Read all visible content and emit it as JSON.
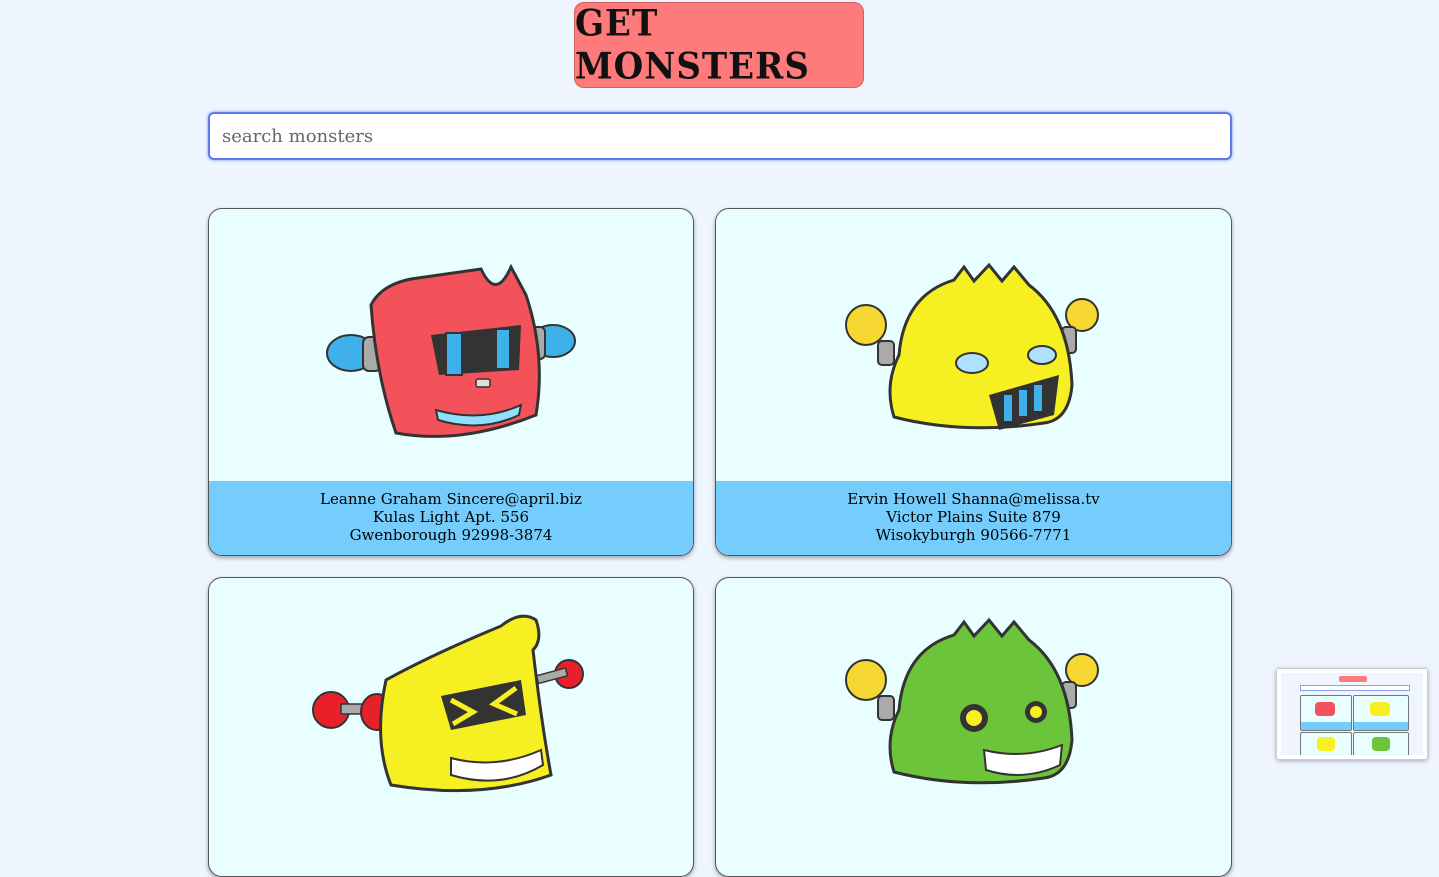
{
  "header": {
    "title": "GET MONSTERS"
  },
  "search": {
    "placeholder": "search monsters",
    "value": ""
  },
  "monsters": [
    {
      "name_email": "Leanne Graham Sincere@april.biz",
      "street": "Kulas Light Apt. 556",
      "city_zip": "Gwenborough 92998-3874",
      "color": "#f4525a"
    },
    {
      "name_email": "Ervin Howell Shanna@melissa.tv",
      "street": "Victor Plains Suite 879",
      "city_zip": "Wisokyburgh 90566-7771",
      "color": "#f6ef22"
    },
    {
      "name_email": "",
      "street": "",
      "city_zip": "",
      "color": "#f6ef22"
    },
    {
      "name_email": "",
      "street": "",
      "city_zip": "",
      "color": "#6cc43a"
    }
  ],
  "icons": {
    "robot": "robot-monster-icon"
  },
  "colors": {
    "background": "#eef5ff",
    "title_bg": "#ff7a7a",
    "card_bg": "#e9ffff",
    "card_info": "#74cdfc"
  }
}
